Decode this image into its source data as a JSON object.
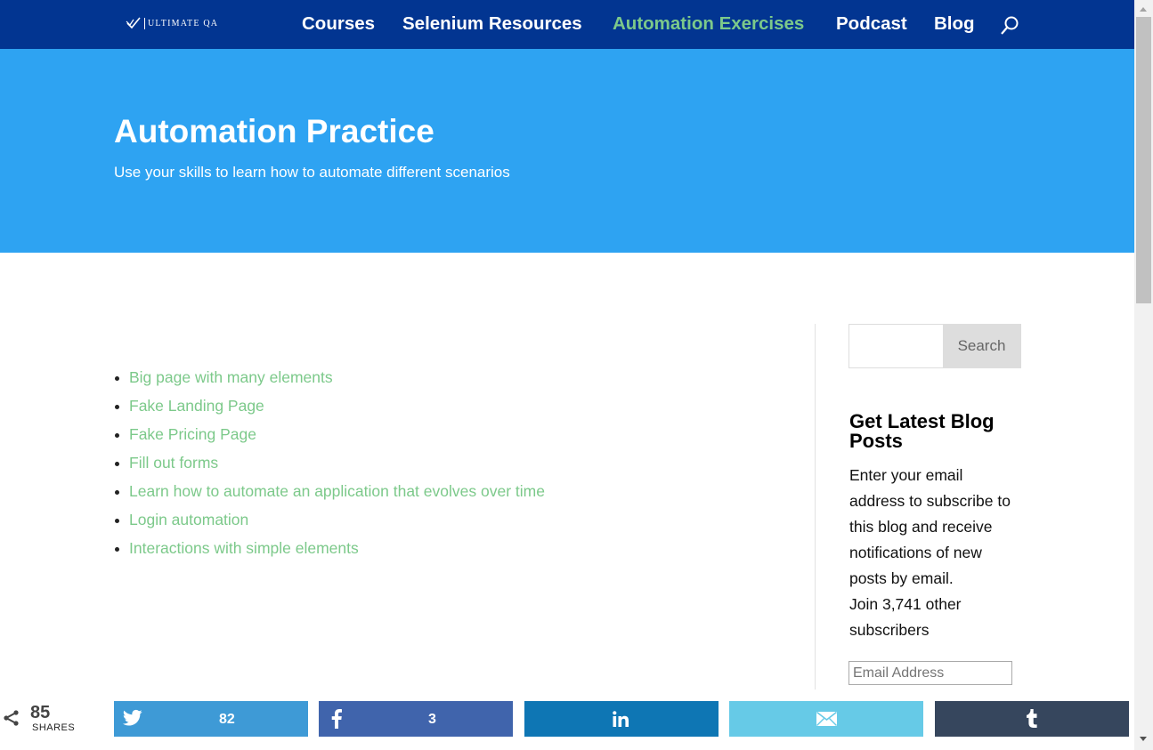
{
  "logo": {
    "text": "ULTIMATE QA",
    "icon": "check-shield-icon"
  },
  "nav": {
    "items": [
      {
        "label": "Courses",
        "active": false
      },
      {
        "label": "Selenium Resources",
        "active": false
      },
      {
        "label": "Automation Exercises",
        "active": true
      },
      {
        "label": "Podcast",
        "active": false
      },
      {
        "label": "Blog",
        "active": false
      }
    ],
    "search_icon": "search-icon"
  },
  "hero": {
    "title": "Automation Practice",
    "subtitle": "Use your skills to learn how to automate different scenarios"
  },
  "links": [
    "Big page with many elements",
    "Fake Landing Page",
    "Fake Pricing Page",
    "Fill out forms",
    "Learn how to automate an application that evolves over time",
    "Login automation",
    "Interactions with simple elements"
  ],
  "sidebar": {
    "search_button": "Search",
    "widget_title": "Get Latest Blog Posts",
    "widget_description": "Enter your email address to subscribe to this blog and receive notifications of new posts by email.",
    "subscriber_text": "Join 3,741 other subscribers",
    "email_placeholder": "Email Address"
  },
  "share": {
    "total": "85",
    "label": "SHARES",
    "buttons": [
      {
        "network": "twitter",
        "icon": "twitter-icon",
        "count": "82",
        "color": "#3e9ad6"
      },
      {
        "network": "facebook",
        "icon": "facebook-icon",
        "count": "3",
        "color": "#4064ac"
      },
      {
        "network": "linkedin",
        "icon": "linkedin-icon",
        "count": "",
        "color": "#0e76b4"
      },
      {
        "network": "email",
        "icon": "email-icon",
        "count": "",
        "color": "#66cae7"
      },
      {
        "network": "tumblr",
        "icon": "tumblr-icon",
        "count": "",
        "color": "#36465d"
      }
    ]
  },
  "colors": {
    "topbar": "#023591",
    "hero": "#2ea3f2",
    "accent_green": "#7cc98a"
  }
}
